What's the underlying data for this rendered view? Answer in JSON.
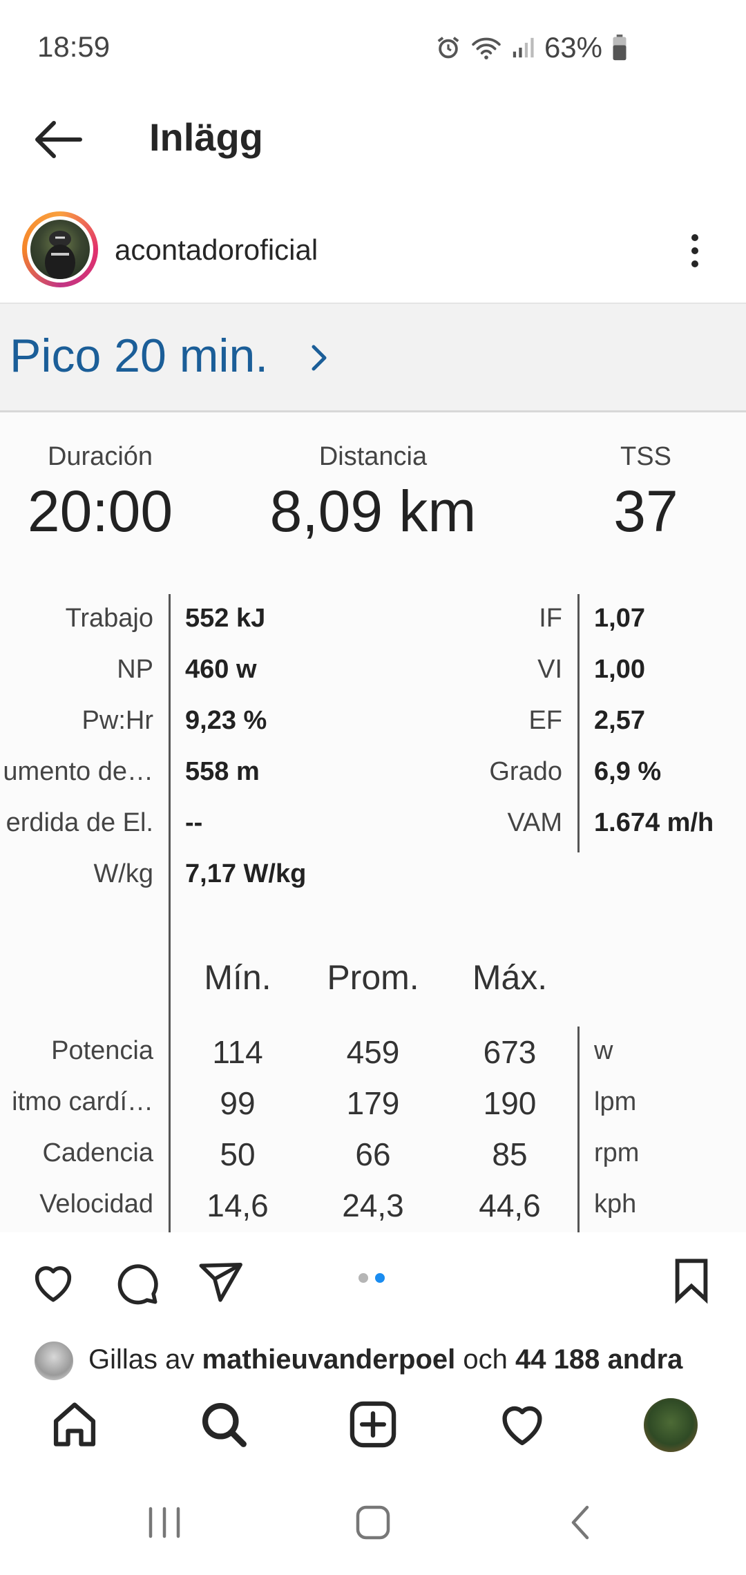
{
  "status_bar": {
    "time": "18:59",
    "battery": "63%"
  },
  "header": {
    "title": "Inlägg"
  },
  "post_author": {
    "username": "acontadoroficial"
  },
  "workout": {
    "title": "Pico 20 min.",
    "summary": [
      {
        "label": "Duración",
        "value": "20:00"
      },
      {
        "label": "Distancia",
        "value": "8,09 km"
      },
      {
        "label": "TSS",
        "value": "37"
      }
    ],
    "metrics_left": [
      {
        "label": "Trabajo",
        "value": "552 kJ"
      },
      {
        "label": "NP",
        "value": "460 w"
      },
      {
        "label": "Pw:Hr",
        "value": "9,23 %"
      },
      {
        "label": "umento de…",
        "value": "558 m"
      },
      {
        "label": "erdida de El.",
        "value": "--"
      },
      {
        "label": "W/kg",
        "value": "7,17 W/kg"
      }
    ],
    "metrics_right": [
      {
        "label": "IF",
        "value": "1,07"
      },
      {
        "label": "VI",
        "value": "1,00"
      },
      {
        "label": "EF",
        "value": "2,57"
      },
      {
        "label": "Grado",
        "value": "6,9 %"
      },
      {
        "label": "VAM",
        "value": "1.674 m/h"
      }
    ],
    "table_headers": [
      "Mín.",
      "Prom.",
      "Máx."
    ],
    "table_rows": [
      {
        "label": "Potencia",
        "min": "114",
        "avg": "459",
        "max": "673",
        "unit": "w"
      },
      {
        "label": "itmo cardí…",
        "min": "99",
        "avg": "179",
        "max": "190",
        "unit": "lpm"
      },
      {
        "label": "Cadencia",
        "min": "50",
        "avg": "66",
        "max": "85",
        "unit": "rpm"
      },
      {
        "label": "Velocidad",
        "min": "14,6",
        "avg": "24,3",
        "max": "44,6",
        "unit": "kph"
      }
    ]
  },
  "carousel": {
    "current": 2,
    "total": 2
  },
  "likes": {
    "prefix": "Gillas av",
    "user": "mathieuvanderpoel",
    "middle": "och",
    "count": "44 188 andra"
  },
  "icons": {
    "back": "arrow-left-icon",
    "more": "more-vertical-icon",
    "like": "heart-icon",
    "comment": "comment-icon",
    "share": "send-icon",
    "save": "bookmark-icon",
    "home": "home-icon",
    "search": "search-icon",
    "create": "plus-square-icon",
    "activity": "heart-icon",
    "profile": "avatar"
  },
  "colors": {
    "accent_blue": "#1b5e98",
    "dot_active": "#1a8cf0",
    "dot_inactive": "#b5b5b5"
  }
}
